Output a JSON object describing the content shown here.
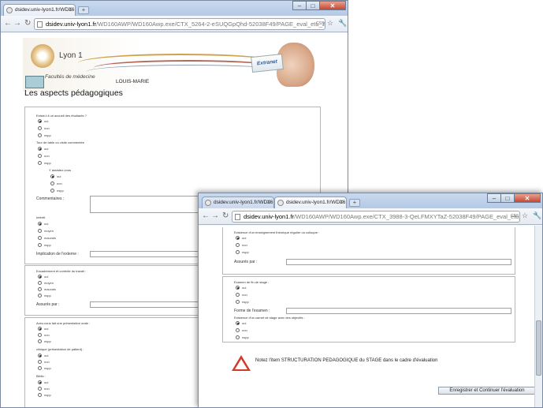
{
  "win1": {
    "tab_title": "dsidev.univ-lyon1.fr/WD16",
    "url_host": "dsidev.univ-lyon1.fr",
    "url_path": "/WD160AWP/WD160Awp.exe/CTX_5264-2-eSUQGpQhd-52038F49/PAGE_eval_etu_2/SYN(",
    "css_badge": "CSS",
    "header": {
      "logo_small": "ufc",
      "logo_text": "Lyon 1",
      "faculty": "Facultés de médecine",
      "extranet": "Extranet",
      "student_name": "LOUIS-MARIE",
      "page_title": "Les aspects pédagogiques"
    },
    "section1": {
      "q1": "Existe-t-il un accueil des étudiants ?",
      "q1_opts": [
        "oui",
        "non",
        "nspp"
      ],
      "q2": "Tour de table ou visite commentée",
      "q2_opts": [
        "oui",
        "non",
        "nspp"
      ],
      "q2_sub": "Y assistez-vous",
      "q2_sub_opts": [
        "oui",
        "non",
        "nspp"
      ],
      "comment_label": "Commentaires :",
      "q3": "Intérêt",
      "q3_opts": [
        "oui",
        "moyen",
        "mauvais",
        "nspp"
      ],
      "implication_label": "Implication de l'externe :"
    },
    "section2": {
      "q1": "Encadrement et contrôle du travail :",
      "q1_opts": [
        "oui",
        "moyen",
        "mauvais",
        "nspp"
      ],
      "assured_label": "Assurés par :"
    },
    "section3": {
      "q1": "Avez-vous fait une présentation orale :",
      "q1_opts": [
        "oui",
        "non",
        "nspp"
      ],
      "q2": "clinique (présentation de patient) :",
      "q2_opts": [
        "oui",
        "non",
        "nspp"
      ],
      "q3": "Biblio :",
      "q3_opts": [
        "oui",
        "non",
        "nspp"
      ]
    }
  },
  "win2": {
    "tab1_title": "dsidev.univ-lyon1.fr/WD16",
    "tab2_title": "dsidev.univ-lyon1.fr/WD16",
    "url_host": "dsidev.univ-lyon1.fr",
    "url_path": "/WD160AWP/WD160Awp.exe/CTX_3988-3-QeLFMXYTaZ-52038F49/PAGE_eval_etu_2/SYN(",
    "css_badge": "CSS",
    "sectionA": {
      "q1": "Existence d'un enseignement théorique régulier ou colloque :",
      "q1_opts": [
        "oui",
        "non",
        "nspp"
      ],
      "assured_label": "Assurés par :"
    },
    "sectionB": {
      "q1": "Examen de fin de stage :",
      "q1_opts": [
        "oui",
        "non",
        "nspp"
      ],
      "exam_form_label": "Forme de l'examen :",
      "q2": "Existence d'un carnet de stage avec des objectifs :",
      "q2_opts": [
        "oui",
        "non",
        "nspp"
      ]
    },
    "note": "Notez l'item  STRUCTURATION PEDAGOGIQUE  du STAGE dans le cadre d'évaluation",
    "save_button": "Enregistrer et Continuer l'évaluation"
  }
}
